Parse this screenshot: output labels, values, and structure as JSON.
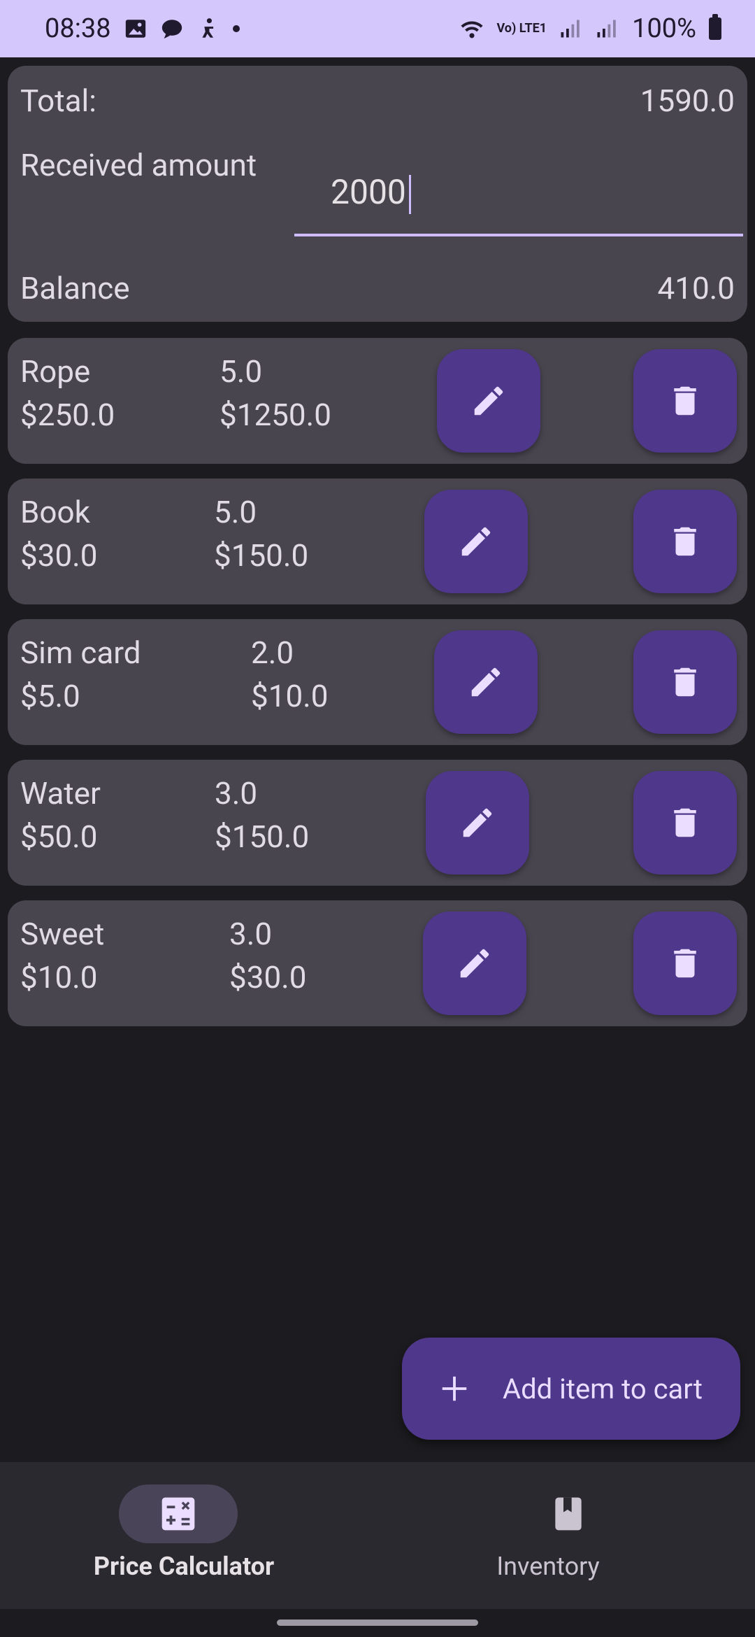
{
  "status_bar": {
    "time": "08:38",
    "network_label": "Vo) LTE1",
    "battery": "100%"
  },
  "summary": {
    "total_label": "Total:",
    "total_value": "1590.0",
    "received_label": "Received amount",
    "received_value": "2000",
    "balance_label": "Balance",
    "balance_value": "410.0"
  },
  "items": [
    {
      "name": "Rope",
      "qty": "5.0",
      "price": "$250.0",
      "subtotal": "$1250.0"
    },
    {
      "name": "Book",
      "qty": "5.0",
      "price": "$30.0",
      "subtotal": "$150.0"
    },
    {
      "name": "Sim card",
      "qty": "2.0",
      "price": "$5.0",
      "subtotal": "$10.0"
    },
    {
      "name": "Water",
      "qty": "3.0",
      "price": "$50.0",
      "subtotal": "$150.0"
    },
    {
      "name": "Sweet",
      "qty": "3.0",
      "price": "$10.0",
      "subtotal": "$30.0"
    }
  ],
  "fab": {
    "label": "Add item to cart",
    "icon": "plus-icon"
  },
  "nav": [
    {
      "label": "Price Calculator",
      "icon": "calculator-icon",
      "selected": true
    },
    {
      "label": "Inventory",
      "icon": "book-icon",
      "selected": false
    }
  ],
  "colors": {
    "accent": "#cfbcff",
    "button": "#4f378b",
    "card": "#49454f",
    "background": "#1c1b1f",
    "status_bar": "#d4c7fb"
  }
}
